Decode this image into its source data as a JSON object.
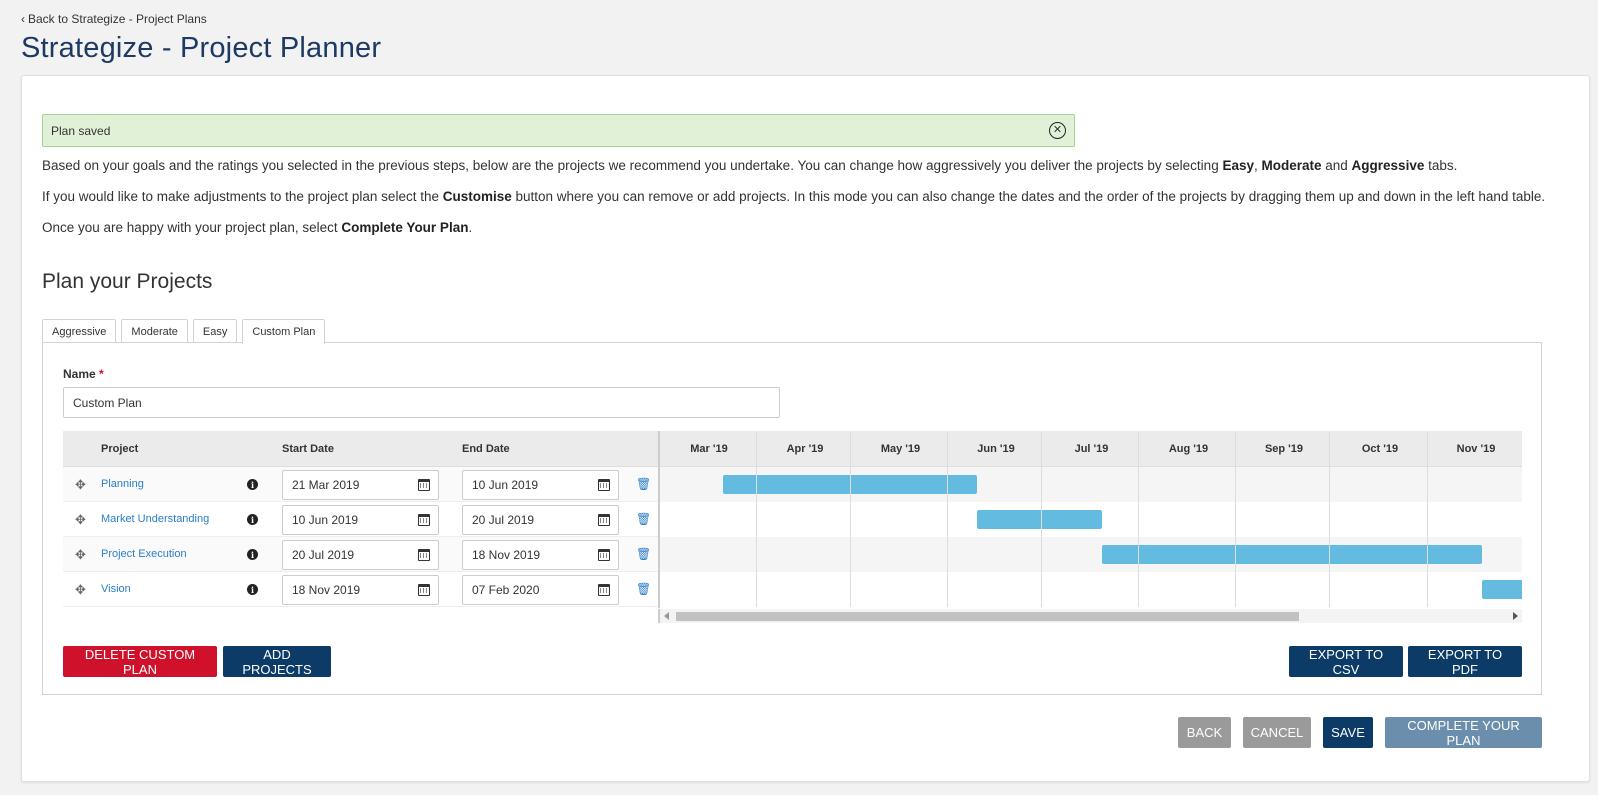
{
  "header": {
    "back_label": "Back to Strategize - Project Plans",
    "title": "Strategize - Project Planner"
  },
  "alert": {
    "text": "Plan saved"
  },
  "intro": {
    "p1_a": "Based on your goals and the ratings you selected in the previous steps, below are the projects we recommend you undertake. You can change how aggressively you deliver the projects by selecting ",
    "p1_easy": "Easy",
    "p1_sep1": ", ",
    "p1_moderate": "Moderate",
    "p1_and": " and ",
    "p1_aggressive": "Aggressive",
    "p1_end": " tabs.",
    "p2_a": "If you would like to make adjustments to the project plan select the ",
    "p2_customise": "Customise",
    "p2_b": " button where you can remove or add projects. In this mode you can also change the dates and the order of the projects by dragging them up and down in the left hand table.",
    "p3_a": "Once you are happy with your project plan, select ",
    "p3_complete": "Complete Your Plan",
    "p3_end": "."
  },
  "section_title": "Plan your Projects",
  "tabs": [
    {
      "label": "Aggressive",
      "active": false
    },
    {
      "label": "Moderate",
      "active": false
    },
    {
      "label": "Easy",
      "active": false
    },
    {
      "label": "Custom Plan",
      "active": true
    }
  ],
  "form": {
    "name_label": "Name",
    "required_mark": "*",
    "name_value": "Custom Plan"
  },
  "table": {
    "col_project": "Project",
    "col_start": "Start Date",
    "col_end": "End Date",
    "rows": [
      {
        "project": "Planning",
        "start": "21 Mar 2019",
        "end": "10 Jun 2019"
      },
      {
        "project": "Market Understanding",
        "start": "10 Jun 2019",
        "end": "20 Jul 2019"
      },
      {
        "project": "Project Execution",
        "start": "20 Jul 2019",
        "end": "18 Nov 2019"
      },
      {
        "project": "Vision",
        "start": "18 Nov 2019",
        "end": "07 Feb 2020"
      }
    ]
  },
  "gantt": {
    "months": [
      "Mar '19",
      "Apr '19",
      "May '19",
      "Jun '19",
      "Jul '19",
      "Aug '19",
      "Sep '19",
      "Oct '19",
      "Nov '19"
    ],
    "bar_color": "#63bbe0",
    "tasks": [
      {
        "name": "Planning",
        "start": "2019-03-21",
        "end": "2019-06-10"
      },
      {
        "name": "Market Understanding",
        "start": "2019-06-10",
        "end": "2019-07-20"
      },
      {
        "name": "Project Execution",
        "start": "2019-07-20",
        "end": "2019-11-18"
      },
      {
        "name": "Vision",
        "start": "2019-11-18",
        "end": "2020-02-07"
      }
    ]
  },
  "panel_buttons": {
    "delete": "DELETE CUSTOM PLAN",
    "add": "ADD PROJECTS",
    "export_csv": "EXPORT TO CSV",
    "export_pdf": "EXPORT TO PDF"
  },
  "footer_buttons": {
    "back": "BACK",
    "cancel": "CANCEL",
    "save": "SAVE",
    "complete": "COMPLETE YOUR PLAN"
  },
  "colors": {
    "title": "#1d3a63",
    "danger": "#d0112b",
    "primary": "#0b3b66",
    "link": "#2a7dc9",
    "success_bg": "#e1f1d8"
  }
}
